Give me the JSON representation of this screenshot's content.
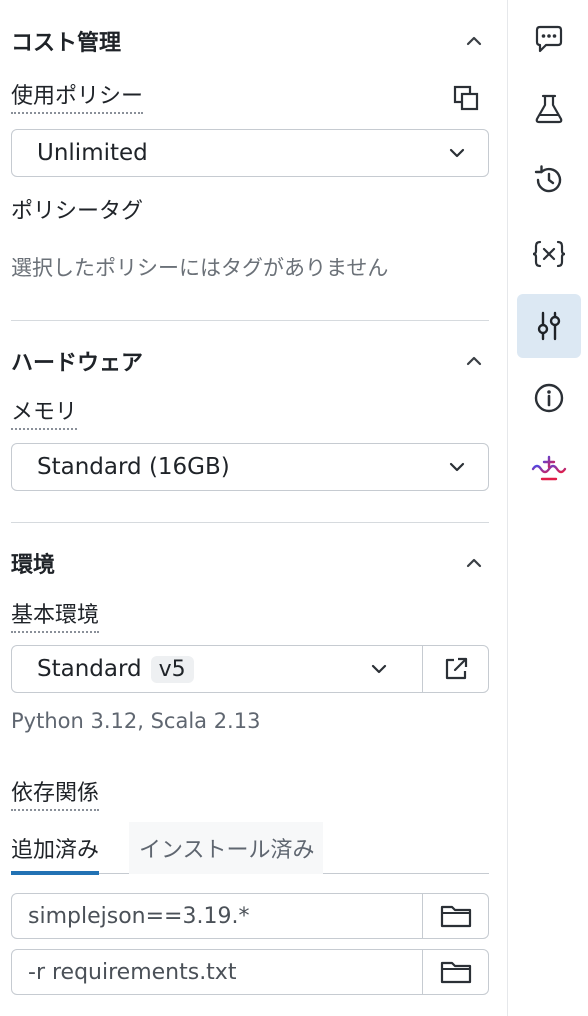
{
  "cost": {
    "title": "コスト管理",
    "policy_label": "使用ポリシー",
    "policy_value": "Unlimited",
    "tags_label": "ポリシータグ",
    "tags_empty": "選択したポリシーにはタグがありません"
  },
  "hardware": {
    "title": "ハードウェア",
    "memory_label": "メモリ",
    "memory_value": "Standard (16GB)"
  },
  "environment": {
    "title": "環境",
    "base_label": "基本環境",
    "base_value": "Standard",
    "base_version": "v5",
    "runtime_info": "Python 3.12, Scala 2.13",
    "deps_label": "依存関係",
    "tabs": [
      {
        "label": "追加済み",
        "active": true
      },
      {
        "label": "インストール済み",
        "active": false
      }
    ],
    "dependencies": [
      {
        "value": "simplejson==3.19.*"
      },
      {
        "value": "-r requirements.txt"
      }
    ]
  },
  "rail": {
    "items": [
      {
        "icon": "comment-icon"
      },
      {
        "icon": "flask-icon"
      },
      {
        "icon": "history-icon"
      },
      {
        "icon": "variables-icon"
      },
      {
        "icon": "sliders-icon",
        "active": true
      },
      {
        "icon": "info-icon"
      },
      {
        "icon": "assistant-icon"
      }
    ]
  },
  "colors": {
    "accent": "#2272b4",
    "active_rail_bg": "#dce8f3",
    "border": "#c6cbd1"
  }
}
